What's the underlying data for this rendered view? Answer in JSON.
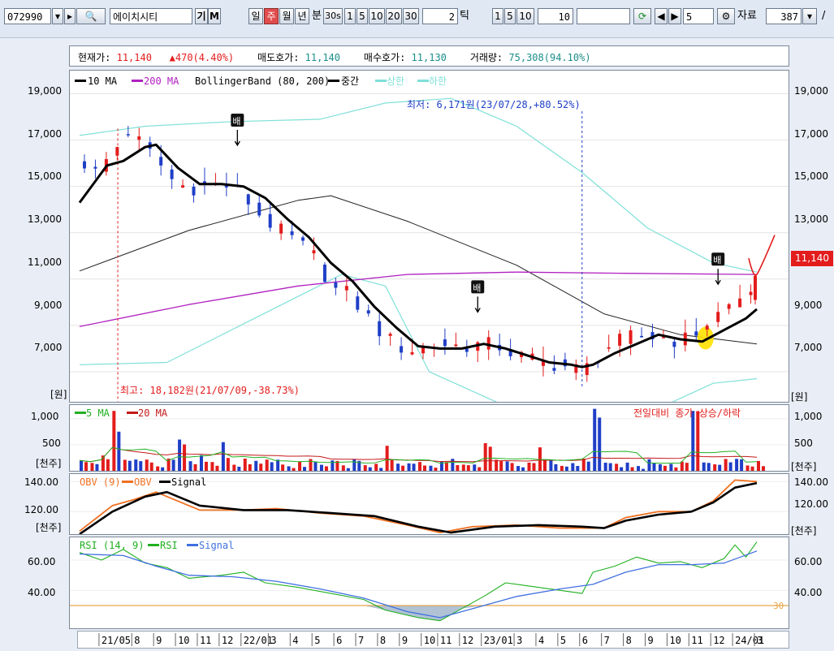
{
  "toolbar": {
    "code": "072990",
    "name": "에이치시티",
    "btn_gi": "기",
    "btn_m": "M",
    "period_day": "일",
    "period_week": "주",
    "period_month": "월",
    "period_year": "년",
    "period_min": "분",
    "min_opt": "30s",
    "min_btns": [
      "1",
      "5",
      "10",
      "20",
      "30"
    ],
    "tick_value": "2",
    "tick_label": "틱",
    "tick_btns": [
      "1",
      "5",
      "10"
    ],
    "tick_custom": "10",
    "count_value": "5",
    "data_label": "자료",
    "data_value": "387"
  },
  "info": {
    "price_label": "현재가:",
    "price": "11,140",
    "change": "470(4.40%)",
    "ask_label": "매도호가:",
    "ask": "11,140",
    "bid_label": "매수호가:",
    "bid": "11,130",
    "volume_label": "거래량:",
    "volume": "75,308(94.10%)"
  },
  "colors": {
    "up": "#e31c1c",
    "down": "#1f3fc7",
    "ma10": "#000000",
    "ma200": "#b020c0",
    "band": "#7fe0d8",
    "mid": "#000000",
    "obv": "#f07020",
    "rsi": "#20b020",
    "rsi_signal": "#4070e0",
    "highlight": "#ffe100"
  },
  "chart_data": [
    {
      "type": "candlestick",
      "legend": [
        "10 MA",
        "200 MA",
        "BollingerBand (80, 200)",
        "중간",
        "상한",
        "하한"
      ],
      "ylim": [
        5700,
        20000
      ],
      "yticks": [
        "19,000",
        "17,000",
        "15,000",
        "13,000",
        "11,000",
        "9,000",
        "7,000"
      ],
      "yticks_right_extra": "11,140",
      "unit_label": "[원]",
      "annotations": {
        "low_note": "최저: 6,171원(23/07/28,+80.52%)",
        "high_note": "최고: 18,182원(21/07/09,-38.73%)",
        "marker": "배"
      },
      "x_labels": [
        "21/05",
        "8",
        "9",
        "10",
        "11",
        "12",
        "22/01",
        "3",
        "4",
        "5",
        "6",
        "7",
        "8",
        "9",
        "10",
        "11",
        "12",
        "23/01",
        "3",
        "4",
        "5",
        "6",
        "7",
        "8",
        "9",
        "10",
        "11",
        "12",
        "24/01",
        "3"
      ],
      "close_path": [
        [
          0,
          16200
        ],
        [
          1.5,
          15600
        ],
        [
          3,
          16400
        ],
        [
          4.5,
          17400
        ],
        [
          6,
          16700
        ],
        [
          7,
          16200
        ],
        [
          8.5,
          15300
        ],
        [
          10,
          14900
        ],
        [
          12,
          15100
        ],
        [
          14,
          15000
        ],
        [
          15,
          14600
        ],
        [
          16.5,
          13800
        ],
        [
          18,
          13200
        ],
        [
          20,
          12600
        ],
        [
          22,
          11800
        ],
        [
          23,
          10600
        ],
        [
          24.5,
          10400
        ],
        [
          26,
          9600
        ],
        [
          28,
          8500
        ],
        [
          30,
          7900
        ],
        [
          31,
          8000
        ],
        [
          33,
          8200
        ],
        [
          35,
          8100
        ],
        [
          37,
          8200
        ],
        [
          38.5,
          8100
        ],
        [
          40,
          7700
        ],
        [
          41,
          7600
        ],
        [
          42.5,
          7400
        ],
        [
          44,
          7300
        ],
        [
          45.5,
          7100
        ],
        [
          46,
          7000
        ],
        [
          47,
          7400
        ],
        [
          48,
          8000
        ],
        [
          49.5,
          8300
        ],
        [
          51,
          8600
        ],
        [
          52,
          8500
        ],
        [
          53.5,
          8500
        ],
        [
          55,
          8300
        ],
        [
          56,
          8500
        ],
        [
          57,
          8900
        ],
        [
          58,
          9300
        ],
        [
          59,
          9700
        ],
        [
          60,
          10000
        ],
        [
          61,
          10300
        ],
        [
          62,
          10900
        ]
      ],
      "last_candle": {
        "open": 10100,
        "close": 11140,
        "high": 11140,
        "low": 9900
      },
      "ma10_path": [
        [
          0,
          14300
        ],
        [
          2.5,
          15900
        ],
        [
          4,
          16100
        ],
        [
          6,
          16700
        ],
        [
          7,
          16800
        ],
        [
          9,
          15800
        ],
        [
          11,
          15100
        ],
        [
          13,
          15100
        ],
        [
          15,
          15000
        ],
        [
          17,
          14500
        ],
        [
          19,
          13600
        ],
        [
          21,
          12800
        ],
        [
          23,
          11700
        ],
        [
          25,
          10900
        ],
        [
          27,
          9800
        ],
        [
          29,
          8900
        ],
        [
          31,
          8100
        ],
        [
          33,
          8000
        ],
        [
          35,
          8000
        ],
        [
          37,
          8200
        ],
        [
          39,
          8000
        ],
        [
          41,
          7700
        ],
        [
          43,
          7400
        ],
        [
          45,
          7300
        ],
        [
          46,
          7200
        ],
        [
          47,
          7300
        ],
        [
          49,
          7800
        ],
        [
          51,
          8200
        ],
        [
          53,
          8600
        ],
        [
          55,
          8400
        ],
        [
          57,
          8300
        ],
        [
          59,
          8800
        ],
        [
          61,
          9300
        ],
        [
          62,
          9700
        ]
      ],
      "ma200_path": [
        [
          0,
          8950
        ],
        [
          10,
          9900
        ],
        [
          20,
          10700
        ],
        [
          30,
          11200
        ],
        [
          40,
          11300
        ],
        [
          50,
          11250
        ],
        [
          62,
          11200
        ]
      ],
      "mid_path": [
        [
          0,
          11350
        ],
        [
          10,
          13100
        ],
        [
          20,
          14400
        ],
        [
          23,
          14600
        ],
        [
          30,
          13500
        ],
        [
          40,
          11600
        ],
        [
          48,
          9500
        ],
        [
          55,
          8600
        ],
        [
          62,
          8200
        ]
      ],
      "upper_path": [
        [
          0,
          17200
        ],
        [
          6,
          17600
        ],
        [
          14,
          17800
        ],
        [
          22,
          17900
        ],
        [
          28,
          18600
        ],
        [
          34,
          18800
        ],
        [
          40,
          17600
        ],
        [
          46,
          15600
        ],
        [
          52,
          13200
        ],
        [
          58,
          11700
        ],
        [
          62,
          11300
        ]
      ],
      "lower_path": [
        [
          0,
          7300
        ],
        [
          8,
          7400
        ],
        [
          16,
          9300
        ],
        [
          24,
          11200
        ],
        [
          28,
          10700
        ],
        [
          32,
          7000
        ],
        [
          40,
          5300
        ],
        [
          46,
          5000
        ],
        [
          52,
          5200
        ],
        [
          58,
          6500
        ],
        [
          62,
          6700
        ]
      ]
    },
    {
      "type": "bar",
      "legend": [
        "5 MA",
        "20 MA"
      ],
      "note": "전일대비 종가 상승/하락",
      "ylim": [
        0,
        1200
      ],
      "yticks": [
        "1,000",
        "500"
      ],
      "unit_label": "[천주]",
      "spikes": [
        [
          3,
          1150
        ],
        [
          9,
          600
        ],
        [
          13,
          550
        ],
        [
          28,
          480
        ],
        [
          37,
          530
        ],
        [
          42,
          450
        ],
        [
          47,
          1190
        ],
        [
          56,
          1150
        ]
      ]
    },
    {
      "type": "line",
      "legend": [
        "OBV (9)",
        "OBV",
        "Signal"
      ],
      "ylim": [
        105,
        145
      ],
      "yticks": [
        "140.00",
        "120.00"
      ],
      "unit_label": "[천주]",
      "obv_path": [
        [
          0,
          107
        ],
        [
          3,
          124
        ],
        [
          5,
          128
        ],
        [
          7,
          133
        ],
        [
          9,
          127
        ],
        [
          11,
          121
        ],
        [
          15,
          121
        ],
        [
          18,
          122
        ],
        [
          22,
          119
        ],
        [
          26,
          117
        ],
        [
          30,
          111
        ],
        [
          33,
          106
        ],
        [
          36,
          110
        ],
        [
          40,
          111
        ],
        [
          44,
          109
        ],
        [
          48,
          109
        ],
        [
          50,
          116
        ],
        [
          53,
          120
        ],
        [
          56,
          120
        ],
        [
          58,
          127
        ],
        [
          60,
          141
        ],
        [
          62,
          140
        ]
      ],
      "signal_path": [
        [
          0,
          105
        ],
        [
          3,
          120
        ],
        [
          6,
          130
        ],
        [
          8,
          133
        ],
        [
          11,
          124
        ],
        [
          15,
          121
        ],
        [
          19,
          121
        ],
        [
          23,
          119
        ],
        [
          27,
          117
        ],
        [
          31,
          110
        ],
        [
          34,
          106
        ],
        [
          38,
          110
        ],
        [
          42,
          111
        ],
        [
          46,
          110
        ],
        [
          48,
          109
        ],
        [
          50,
          114
        ],
        [
          53,
          118
        ],
        [
          56,
          120
        ],
        [
          58,
          126
        ],
        [
          60,
          136
        ],
        [
          62,
          139
        ]
      ]
    },
    {
      "type": "line",
      "legend": [
        "RSI (14, 9)",
        "RSI",
        "Signal"
      ],
      "ylim": [
        15,
        75
      ],
      "yticks": [
        "60.00",
        "40.00"
      ],
      "level": 30,
      "level_label": "30",
      "rsi_path": [
        [
          0,
          65
        ],
        [
          2,
          60
        ],
        [
          4,
          67
        ],
        [
          6,
          58
        ],
        [
          8,
          55
        ],
        [
          10,
          48
        ],
        [
          13,
          50
        ],
        [
          15,
          52
        ],
        [
          17,
          45
        ],
        [
          20,
          42
        ],
        [
          23,
          38
        ],
        [
          26,
          34
        ],
        [
          28,
          27
        ],
        [
          31,
          22
        ],
        [
          33,
          20
        ],
        [
          35,
          28
        ],
        [
          37,
          36
        ],
        [
          39,
          45
        ],
        [
          42,
          42
        ],
        [
          44,
          40
        ],
        [
          46,
          38
        ],
        [
          47,
          52
        ],
        [
          49,
          56
        ],
        [
          51,
          62
        ],
        [
          53,
          58
        ],
        [
          55,
          59
        ],
        [
          57,
          55
        ],
        [
          59,
          61
        ],
        [
          60,
          70
        ],
        [
          61,
          62
        ],
        [
          62,
          72
        ]
      ],
      "signal_path": [
        [
          0,
          64
        ],
        [
          4,
          63
        ],
        [
          7,
          56
        ],
        [
          10,
          50
        ],
        [
          14,
          49
        ],
        [
          18,
          46
        ],
        [
          22,
          41
        ],
        [
          26,
          35
        ],
        [
          30,
          26
        ],
        [
          33,
          22
        ],
        [
          36,
          28
        ],
        [
          40,
          36
        ],
        [
          44,
          41
        ],
        [
          47,
          44
        ],
        [
          50,
          52
        ],
        [
          53,
          57
        ],
        [
          56,
          57
        ],
        [
          59,
          58
        ],
        [
          62,
          66
        ]
      ]
    }
  ]
}
